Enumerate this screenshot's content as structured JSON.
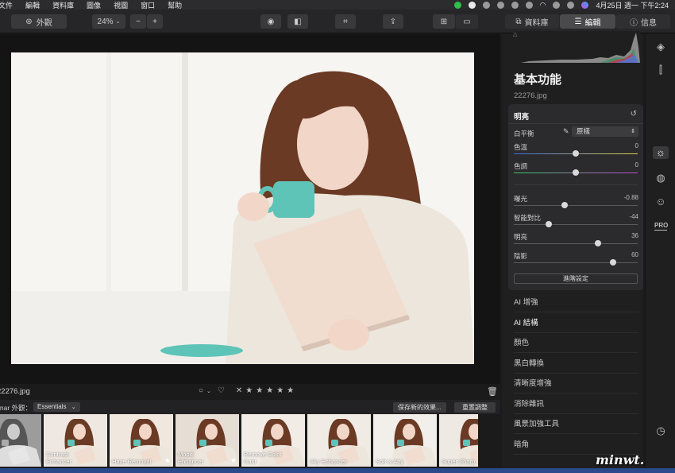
{
  "menubar": {
    "items": [
      "文件",
      "編輯",
      "資料庫",
      "圖像",
      "視圖",
      "窗口",
      "幫助"
    ],
    "clock": "4月25日 週一 下午2:24"
  },
  "toolbar": {
    "view_button": "外觀",
    "zoom": "24%",
    "zoom_out": "−",
    "zoom_in": "+",
    "tabs": [
      "資料庫",
      "編輯",
      "信息"
    ]
  },
  "canvas": {
    "filename": "22276.jpg"
  },
  "presets": {
    "prefix": "inar 外觀：",
    "category": "Essentials",
    "save_button": "保存新的效果...",
    "reset_button": "重置調整",
    "thumbs": [
      {
        "label": ": B&W",
        "star": false
      },
      {
        "label": "Contrast\nEnhancer",
        "star": false
      },
      {
        "label": "Haze Removal",
        "star": true
      },
      {
        "label": "Mood\nEnhancer",
        "star": true
      },
      {
        "label": "Remove Color\nCast",
        "star": false
      },
      {
        "label": "Sky Enhancer",
        "star": false
      },
      {
        "label": "Soft & Airy",
        "star": false
      },
      {
        "label": "Super Sharp",
        "star": false
      }
    ]
  },
  "panel": {
    "title": "基本功能",
    "file": "22276.jpg",
    "section": "明亮",
    "white_balance_label": "白平衡",
    "white_balance_value": "原樣",
    "sliders": [
      {
        "label": "色溫",
        "value": "0",
        "pos": 0.5
      },
      {
        "label": "色調",
        "value": "0",
        "pos": 0.5
      },
      {
        "label": "曝光",
        "value": "-0.88",
        "pos": 0.41
      },
      {
        "label": "智能對比",
        "value": "-44",
        "pos": 0.28
      },
      {
        "label": "明亮",
        "value": "36",
        "pos": 0.68
      },
      {
        "label": "陰影",
        "value": "60",
        "pos": 0.8
      }
    ],
    "advanced_button": "進階設定",
    "tools": [
      "AI 增強",
      "AI 結構",
      "顏色",
      "黑白轉換",
      "清晰度增強",
      "消除雜訊",
      "風景加強工具",
      "暗角"
    ]
  },
  "side": {
    "pro_label": "PRO"
  },
  "watermark": "minwt.com",
  "colors": {
    "accent": "#2a4a8c",
    "menu_highlight": "#d84a8a"
  }
}
